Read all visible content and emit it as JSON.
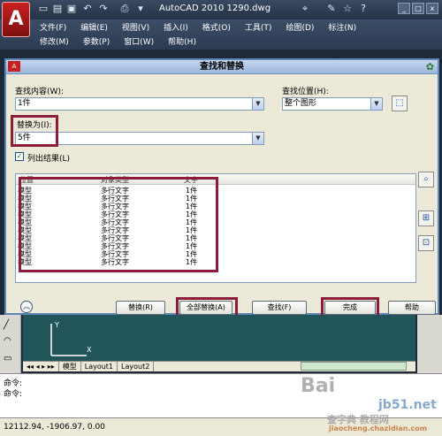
{
  "app": {
    "logo": "A",
    "title": "AutoCAD 2010    1290.dwg",
    "menu_row1": [
      "文件(F)",
      "编辑(E)",
      "视图(V)",
      "插入(I)",
      "格式(O)",
      "工具(T)",
      "绘图(D)",
      "标注(N)"
    ],
    "menu_row2": [
      "修改(M)",
      "参数(P)",
      "窗口(W)",
      "帮助(H)"
    ]
  },
  "dialog": {
    "title": "查找和替换",
    "find_label": "查找内容(W):",
    "find_value": "1件",
    "location_label": "查找位置(H):",
    "location_value": "整个图形",
    "replace_label": "替换为(I):",
    "replace_value": "5件",
    "list_results_label": "列出结果(L)",
    "columns": [
      "位置",
      "对象类型",
      "文字"
    ],
    "rows": [
      [
        "模型",
        "多行文字",
        "1件"
      ],
      [
        "模型",
        "多行文字",
        "1件"
      ],
      [
        "模型",
        "多行文字",
        "1件"
      ],
      [
        "模型",
        "多行文字",
        "1件"
      ],
      [
        "模型",
        "多行文字",
        "1件"
      ],
      [
        "模型",
        "多行文字",
        "1件"
      ],
      [
        "模型",
        "多行文字",
        "1件"
      ],
      [
        "模型",
        "多行文字",
        "1件"
      ],
      [
        "模型",
        "多行文字",
        "1件"
      ],
      [
        "模型",
        "多行文字",
        "1件"
      ]
    ],
    "buttons": {
      "replace": "替换(R)",
      "replace_all": "全部替换(A)",
      "find": "查找(F)",
      "done": "完成",
      "help": "帮助"
    }
  },
  "layout_tabs": [
    "模型",
    "Layout1",
    "Layout2"
  ],
  "command_lines": [
    "命令:",
    "命令:"
  ],
  "status_coords": "12112.94, -1906.97, 0.00",
  "watermarks": {
    "baidu": "Bai",
    "site": "jb51.net",
    "site_sub": "查字典 教程网",
    "url": "jiaocheng.chazidian.com"
  },
  "colors": {
    "highlight_box": "#8c1c3a",
    "canvas": "#22555a"
  }
}
